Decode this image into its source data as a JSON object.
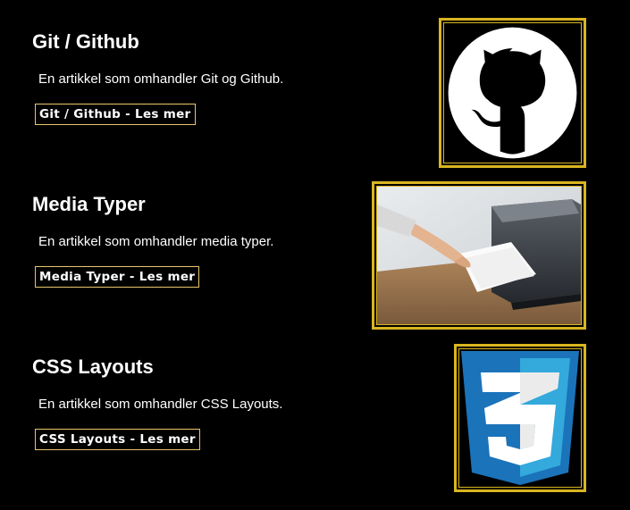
{
  "articles": [
    {
      "title": "Git / Github",
      "description": "En artikkel som omhandler Git og Github.",
      "link_label": "Git / Github - Les mer",
      "image": "github-octocat-logo"
    },
    {
      "title": "Media Typer",
      "description": "En artikkel som omhandler media typer.",
      "link_label": "Media Typer - Les mer",
      "image": "printer-paper-photo"
    },
    {
      "title": "CSS Layouts",
      "description": "En artikkel som omhandler CSS Layouts.",
      "link_label": "CSS Layouts - Les mer",
      "image": "css3-logo"
    }
  ],
  "colors": {
    "background": "#000000",
    "text": "#ffffff",
    "image_border": "#d9b520",
    "link_border": "#e8c66a",
    "css3_dark_blue": "#1b73ba",
    "css3_light_blue": "#33a9dc"
  }
}
